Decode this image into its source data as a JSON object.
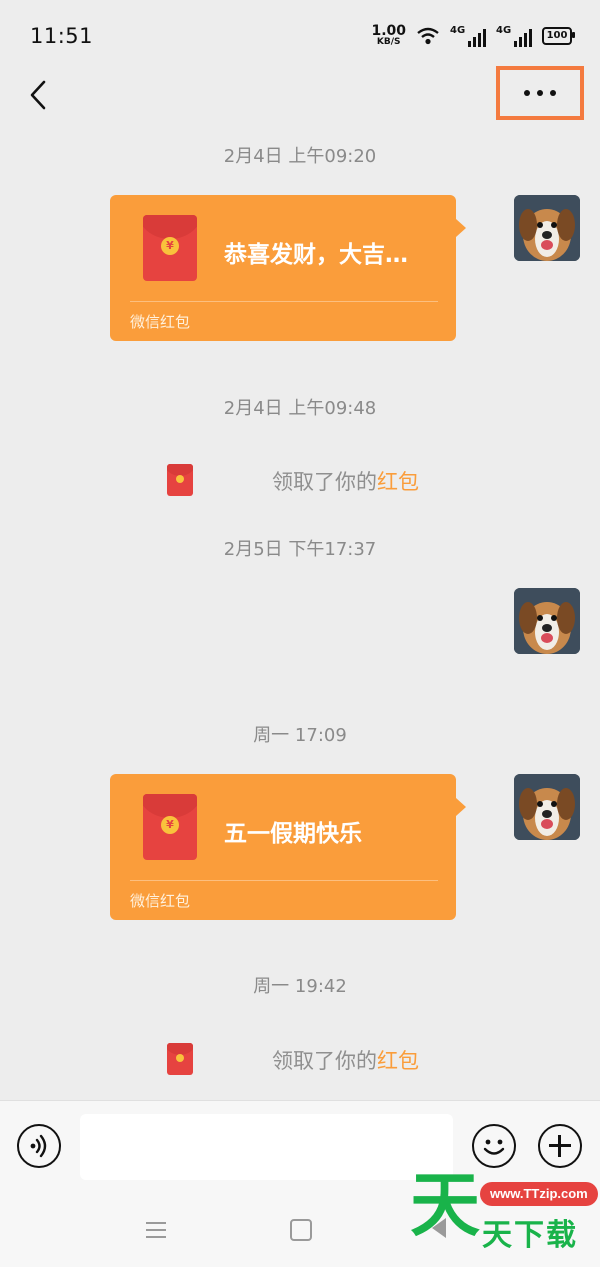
{
  "status_bar": {
    "time": "11:51",
    "net_speed_value": "1.00",
    "net_speed_unit": "KB/S",
    "signal_1_label": "4G",
    "signal_2_label": "4G",
    "battery_level": "100"
  },
  "header": {
    "back_icon": "chevron-left-icon",
    "more_icon": "ellipsis-icon",
    "highlight_color": "#f47a3f"
  },
  "chat": {
    "timestamps": [
      "2月4日 上午09:20",
      "2月4日 上午09:48",
      "2月5日 下午17:37",
      "周一 17:09",
      "周一 19:42"
    ],
    "red_packets": [
      {
        "title": "恭喜发财，大吉…",
        "footer": "微信红包"
      },
      {
        "title": "五一假期快乐",
        "footer": "微信红包"
      }
    ],
    "claim_notices": [
      {
        "prefix": "领取了你的",
        "highlight": "红包"
      },
      {
        "prefix": "领取了你的",
        "highlight": "红包"
      }
    ],
    "packet_color": "#fa9d3b"
  },
  "input_bar": {
    "message_value": "",
    "voice_icon": "voice-icon",
    "emoji_icon": "emoji-icon",
    "plus_icon": "plus-icon"
  },
  "nav_bar": {
    "menu_icon": "menu-icon",
    "home_icon": "home-icon",
    "back_icon": "back-triangle-icon"
  },
  "watermark": {
    "url": "www.TTzip.com",
    "big_char": "天",
    "text": "天下载"
  }
}
